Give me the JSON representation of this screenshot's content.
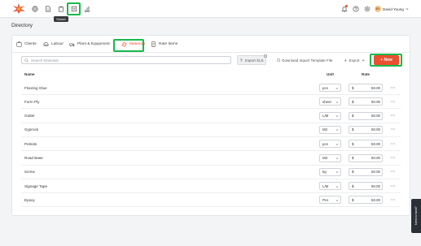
{
  "topbar": {
    "tooltip": "Search",
    "user": {
      "initials": "DY",
      "name": "David Young"
    }
  },
  "page": {
    "title": "Directory"
  },
  "tabs": [
    {
      "label": "Clients",
      "icon": "clients-icon",
      "active": false
    },
    {
      "label": "Labour",
      "icon": "labour-icon",
      "active": false
    },
    {
      "label": "Plant & Equipment",
      "icon": "plant-equipment-icon",
      "active": false
    },
    {
      "label": "Materials",
      "icon": "materials-icon",
      "active": true
    },
    {
      "label": "Rate Items",
      "icon": "rate-items-icon",
      "active": false
    }
  ],
  "toolbar": {
    "search_placeholder": "Search Materials",
    "import_label": "Import XLS",
    "template_label": "Download Import Template File",
    "export_label": "Export",
    "new_label": "+ New"
  },
  "table": {
    "headers": {
      "name": "Name",
      "unit": "Unit",
      "rate": "Rate"
    },
    "currency": "$",
    "rows": [
      {
        "name": "Flooring Glue",
        "unit": "pcs",
        "rate": "50.00"
      },
      {
        "name": "Form Ply",
        "unit": "sheet",
        "rate": "50.00"
      },
      {
        "name": "Gutter",
        "unit": "L/M",
        "rate": "50.00"
      },
      {
        "name": "Gyprock",
        "unit": "M2",
        "rate": "50.00"
      },
      {
        "name": "Pelmits",
        "unit": "pcs",
        "rate": "50.00"
      },
      {
        "name": "Road Base",
        "unit": "M3",
        "rate": "50.00"
      },
      {
        "name": "Screw",
        "unit": "kg",
        "rate": "50.00"
      },
      {
        "name": "Signage Tape",
        "unit": "L/M",
        "rate": "50.00"
      },
      {
        "name": "Epoxy",
        "unit": "Pcs",
        "rate": "50.00"
      }
    ]
  },
  "help": {
    "label": "Need a hand?"
  },
  "colors": {
    "accent": "#e8502f",
    "highlight": "#19b84a"
  }
}
